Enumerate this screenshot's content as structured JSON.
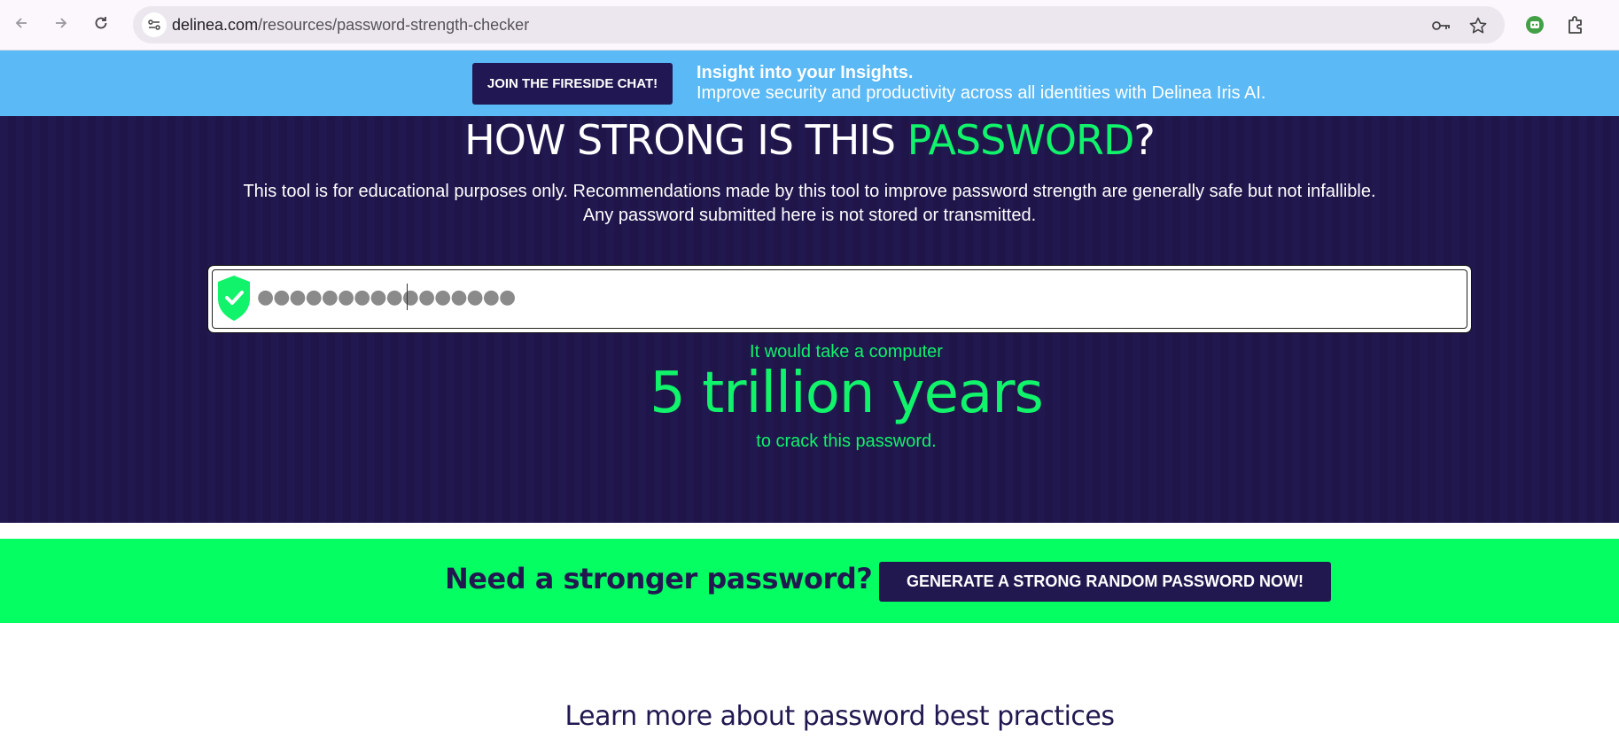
{
  "browser": {
    "url_host": "delinea.com",
    "url_path": "/resources/password-strength-checker",
    "icons": [
      "back-arrow-icon",
      "forward-arrow-icon",
      "reload-icon",
      "site-info-icon",
      "password-key-icon",
      "star-icon",
      "profile-icon",
      "extensions-icon"
    ]
  },
  "banner": {
    "button_label": "JOIN THE FIRESIDE CHAT!",
    "title": "Insight into your Insights.",
    "subtitle": "Improve security and productivity across all identities with Delinea Iris AI.",
    "background": "#5bb9f6"
  },
  "hero": {
    "title_part1": "HOW STRONG IS THIS ",
    "title_accent": "PASSWORD",
    "title_part2": "?",
    "description_line1": "This tool is for educational purposes only. Recommendations made by this tool to improve password strength are generally safe but not infallible.",
    "description_line2": "Any password submitted here is not stored or transmitted.",
    "password_masked": "●●●●●●●●●●●●●●●●",
    "shield_icon": "shield-check-icon",
    "result_prefix": "It would take a computer",
    "result_time": "5 trillion years",
    "result_suffix": "to crack this password.",
    "accent_color": "#10f36a",
    "background": "#221850"
  },
  "cta": {
    "text": "Need a stronger password?",
    "button_label": "GENERATE A STRONG RANDOM PASSWORD NOW!",
    "background": "#05ff63"
  },
  "learn_more": {
    "heading": "Learn more about password best practices"
  }
}
